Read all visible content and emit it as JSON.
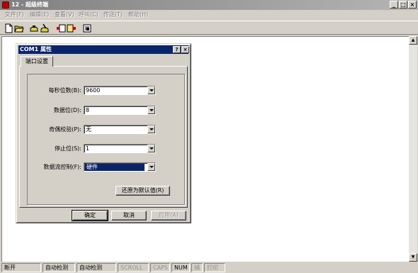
{
  "window": {
    "title": "12 - 超级终端",
    "minimize": "_",
    "maximize": "□",
    "close": "×"
  },
  "menu": [
    "文件(F)",
    "编辑(E)",
    "查看(V)",
    "呼叫(C)",
    "传送(T)",
    "帮助(H)"
  ],
  "toolbar": {
    "icons": [
      "new-icon",
      "open-icon",
      "connect-icon",
      "disconnect-icon",
      "send-icon",
      "receive-icon",
      "properties-icon"
    ]
  },
  "dialog": {
    "title": "COM1 属性",
    "help": "?",
    "close": "×",
    "tab": "端口设置",
    "fields": [
      {
        "label": "每秒位数(B):",
        "value": "9600"
      },
      {
        "label": "数据位(D):",
        "value": "8"
      },
      {
        "label": "奇偶校验(P):",
        "value": "无"
      },
      {
        "label": "停止位(S):",
        "value": "1"
      },
      {
        "label": "数据流控制(F):",
        "value": "硬件"
      }
    ],
    "restore_defaults": "还原为默认值(R)",
    "ok": "确定",
    "cancel": "取消",
    "apply": "应用(A)"
  },
  "statusbar": {
    "items": [
      "断开",
      "自动检测",
      "自动检测",
      "SCROLL",
      "CAPS",
      "NUM",
      "捕",
      "打印"
    ]
  },
  "colors": {
    "dialog_title": "#0a246a",
    "face": "#d4d0c8"
  }
}
